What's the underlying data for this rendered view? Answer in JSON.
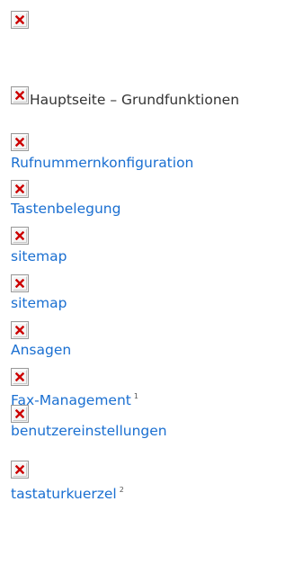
{
  "header": {
    "logo_icon": "broken-image-icon"
  },
  "menu": {
    "items": [
      {
        "label": "Hauptseite – Grundfunktionen",
        "is_link": false,
        "footnote": ""
      },
      {
        "label": "Rufnummernkonfiguration",
        "is_link": true,
        "footnote": ""
      },
      {
        "label": "Tastenbelegung",
        "is_link": true,
        "footnote": ""
      },
      {
        "label": "sitemap",
        "is_link": true,
        "footnote": ""
      },
      {
        "label": "sitemap",
        "is_link": true,
        "footnote": ""
      },
      {
        "label": "Ansagen",
        "is_link": true,
        "footnote": ""
      },
      {
        "label": "Fax-Management",
        "is_link": true,
        "footnote": "1"
      },
      {
        "label": "benutzereinstellungen",
        "is_link": true,
        "footnote": ""
      },
      {
        "label": "tastaturkuerzel",
        "is_link": true,
        "footnote": "2"
      }
    ],
    "icon": "broken-image-icon"
  },
  "colors": {
    "link": "#1a6fd1",
    "text": "#333333",
    "broken_icon_x": "#cc0000"
  }
}
